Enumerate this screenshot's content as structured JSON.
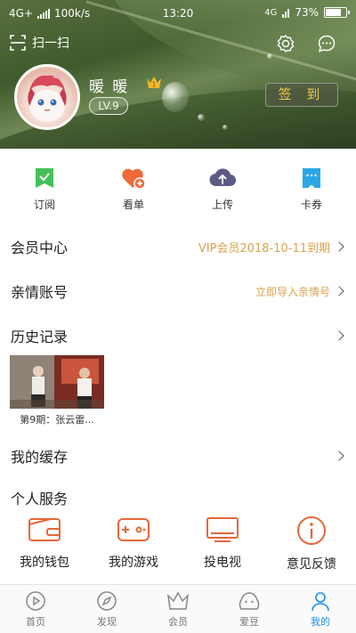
{
  "status_bar": {
    "network": "4G+",
    "speed": "100k/s",
    "time": "13:20",
    "net_right": "4G",
    "battery": "73%"
  },
  "header": {
    "scan_label": "扫一扫",
    "username": "暖 暖",
    "crown_badge": "1",
    "level": "LV.9",
    "signin_label": "签 到",
    "icons": [
      "scan-icon",
      "settings-icon",
      "message-icon"
    ]
  },
  "quick_actions": [
    {
      "label": "订阅",
      "icon": "subscribe-icon",
      "color": "#46c05a"
    },
    {
      "label": "看单",
      "icon": "heart-list-icon",
      "color": "#ef6a3a"
    },
    {
      "label": "上传",
      "icon": "upload-icon",
      "color": "#5d5b86"
    },
    {
      "label": "卡券",
      "icon": "ticket-icon",
      "color": "#2aa8e6"
    }
  ],
  "rows": {
    "vip": {
      "title": "会员中心",
      "extra": "VIP会员2018-10-11到期"
    },
    "family": {
      "title": "亲情账号",
      "extra": "立即导入亲情号"
    },
    "history": {
      "title": "历史记录",
      "item_caption": "第9期：张云雷..."
    },
    "cache": {
      "title": "我的缓存"
    },
    "services": {
      "title": "个人服务"
    }
  },
  "services": [
    {
      "label": "我的钱包",
      "icon": "wallet-icon"
    },
    {
      "label": "我的游戏",
      "icon": "gamepad-icon"
    },
    {
      "label": "投电视",
      "icon": "tv-icon"
    },
    {
      "label": "意见反馈",
      "icon": "feedback-icon"
    }
  ],
  "colors": {
    "accent_orange": "#e6673a",
    "vip_gold": "#d9a44d",
    "active_blue": "#1d8de6"
  },
  "tabbar": [
    {
      "label": "首页",
      "icon": "home-play-icon",
      "active": false
    },
    {
      "label": "发现",
      "icon": "compass-icon",
      "active": false
    },
    {
      "label": "会员",
      "icon": "crown-icon",
      "active": false
    },
    {
      "label": "爱豆",
      "icon": "idol-icon",
      "active": false
    },
    {
      "label": "我的",
      "icon": "profile-icon",
      "active": true
    }
  ]
}
